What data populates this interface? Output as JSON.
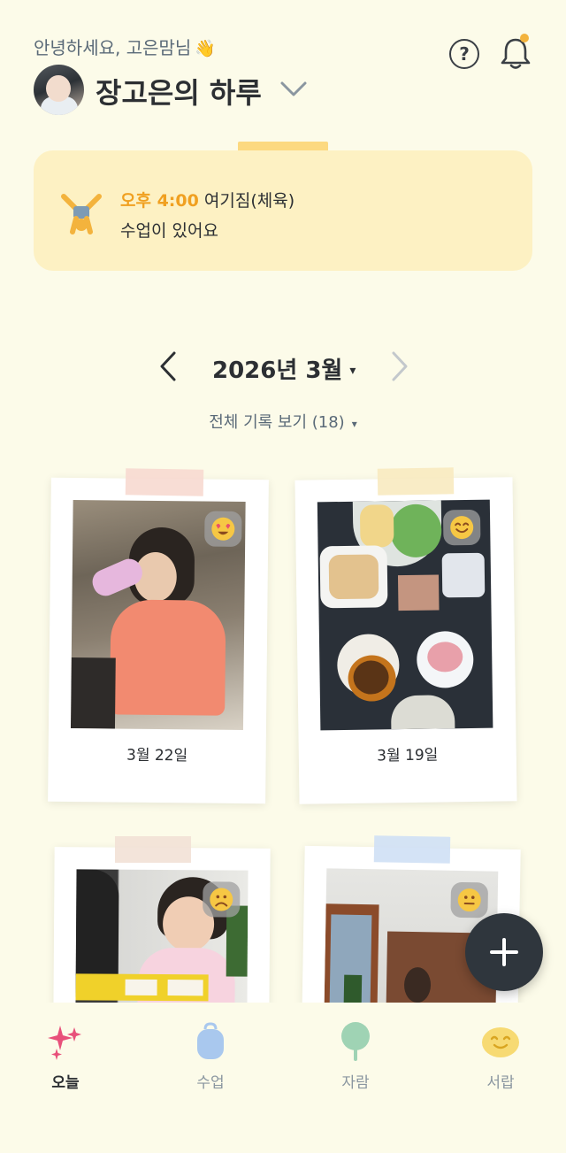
{
  "header": {
    "greeting": "안녕하세요, 고은맘님",
    "greeting_emoji": "👋",
    "child_title": "장고은의 하루",
    "help_icon": "question-circle-icon",
    "bell_icon": "bell-icon",
    "has_notification_dot": true
  },
  "notice": {
    "icon": "gymnast-icon",
    "time": "오후 4:00",
    "class_name": "여기짐(체육)",
    "message": "수업이 있어요"
  },
  "calendar": {
    "month_label": "2026년 3월",
    "caret": "▾",
    "filter_label": "전체 기록 보기 (18)",
    "filter_caret": "▾"
  },
  "records": [
    {
      "caption": "3월 22일",
      "mood": "heart-eyes-face-icon",
      "tape_color": "#f7d9d0"
    },
    {
      "caption": "3월 19일",
      "mood": "smiling-face-icon",
      "tape_color": "#f8eac0"
    },
    {
      "caption": "",
      "mood": "frowning-face-icon",
      "tape_color": "#f2e1d6"
    },
    {
      "caption": "",
      "mood": "neutral-face-icon",
      "tape_color": "#cfe0f5"
    }
  ],
  "fab": {
    "icon": "plus-icon"
  },
  "tabs": [
    {
      "label": "오늘",
      "icon": "sparkles-icon",
      "active": true
    },
    {
      "label": "수업",
      "icon": "backpack-icon",
      "active": false
    },
    {
      "label": "자람",
      "icon": "tree-icon",
      "active": false
    },
    {
      "label": "서랍",
      "icon": "smile-face-icon",
      "active": false
    }
  ],
  "colors": {
    "background": "#fcfbe9",
    "accent": "#f0a020",
    "notice_bg": "#fdf1c3",
    "fab": "#2f363d"
  }
}
